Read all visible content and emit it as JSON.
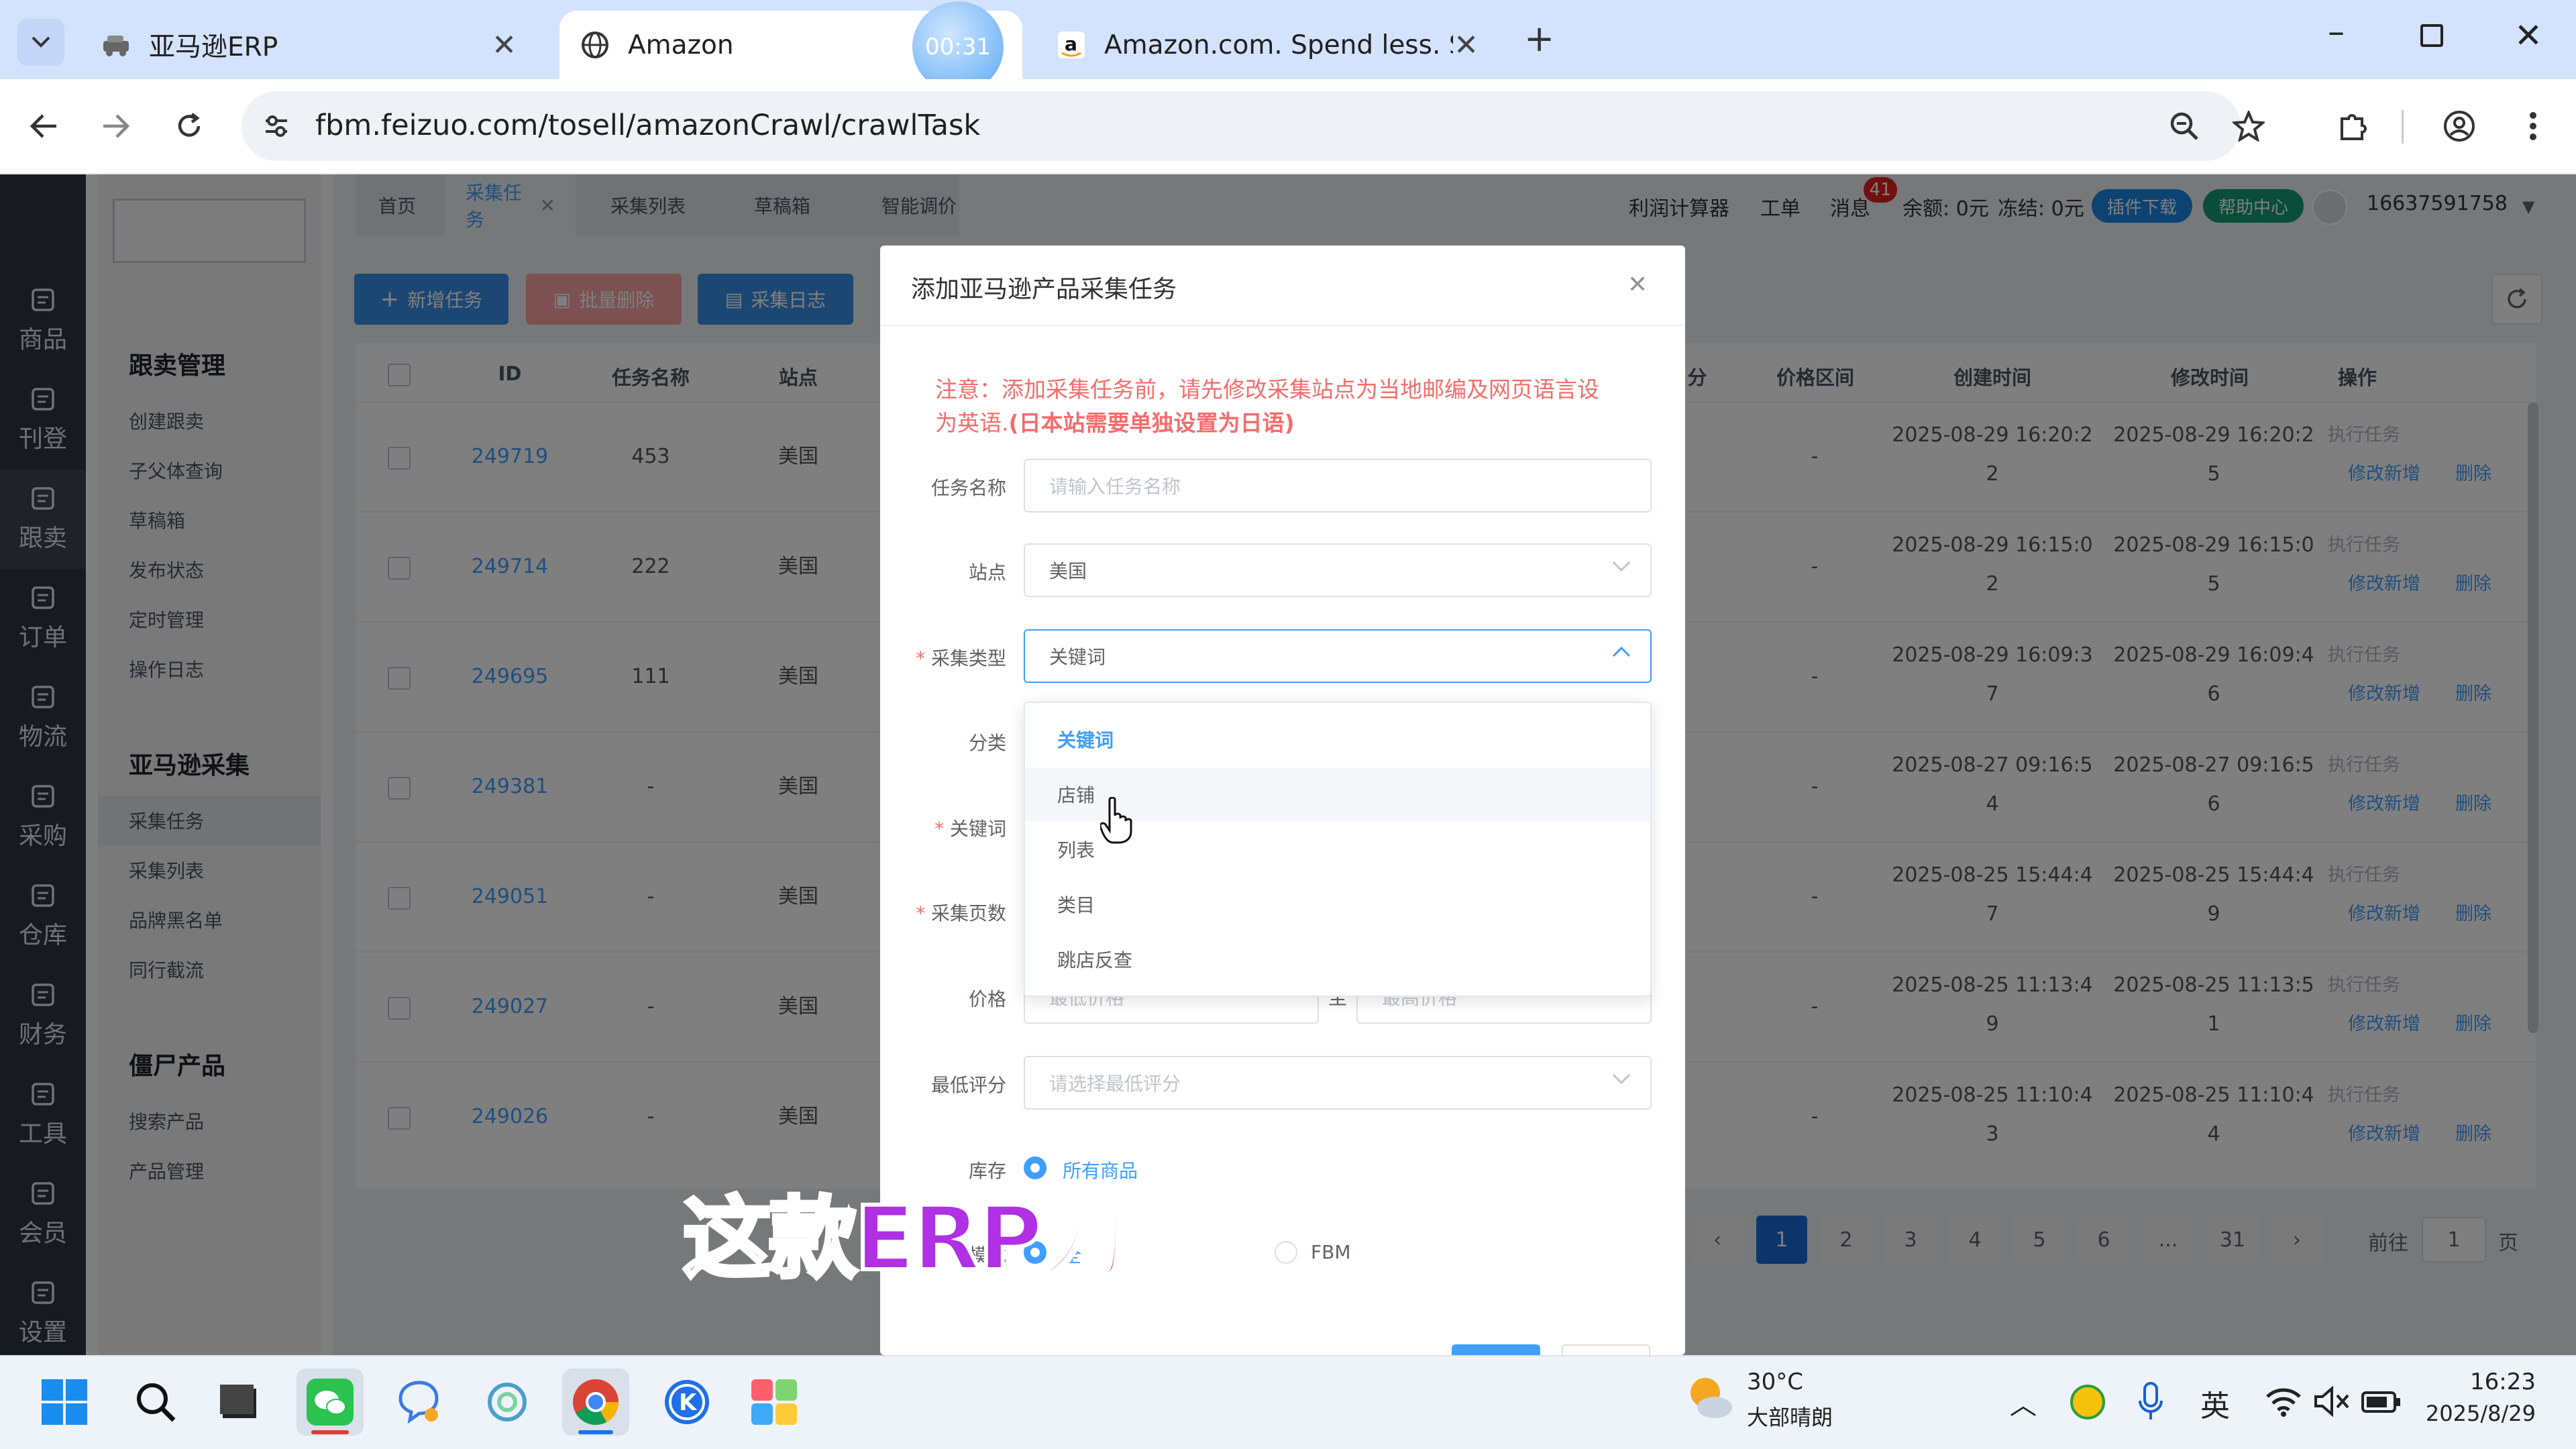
{
  "browser": {
    "tabs": [
      {
        "title": "亚马逊ERP",
        "icon": "car-icon"
      },
      {
        "title": "Amazon",
        "icon": "globe-icon",
        "active": true
      },
      {
        "title": "Amazon.com. Spend less. Sm",
        "icon": "amazon-icon"
      }
    ],
    "timer_badge": "00:31",
    "url": "fbm.feizuo.com/tosell/amazonCrawl/crawlTask"
  },
  "app": {
    "left_nav": [
      {
        "label": "商品",
        "icon": "box-icon"
      },
      {
        "label": "刊登",
        "icon": "publish-icon"
      },
      {
        "label": "跟卖",
        "icon": "follow-icon"
      },
      {
        "label": "订单",
        "icon": "order-icon"
      },
      {
        "label": "物流",
        "icon": "logistics-icon"
      },
      {
        "label": "采购",
        "icon": "cart-icon"
      },
      {
        "label": "仓库",
        "icon": "warehouse-icon"
      },
      {
        "label": "财务",
        "icon": "finance-icon"
      },
      {
        "label": "工具",
        "icon": "tool-icon"
      },
      {
        "label": "会员",
        "icon": "user-icon"
      },
      {
        "label": "设置",
        "icon": "settings-icon"
      }
    ],
    "sidebar": {
      "groups": [
        {
          "title": "跟卖管理",
          "items": [
            "创建跟卖",
            "子父体查询",
            "草稿箱",
            "发布状态",
            "定时管理",
            "操作日志"
          ]
        },
        {
          "title": "亚马逊采集",
          "items": [
            "采集任务",
            "采集列表",
            "品牌黑名单",
            "同行截流"
          ]
        },
        {
          "title": "僵尸产品",
          "items": [
            "搜索产品",
            "产品管理"
          ]
        }
      ]
    },
    "top_tabs": [
      "首页",
      "采集任务",
      "采集列表",
      "草稿箱",
      "智能调价"
    ],
    "header": {
      "links": [
        "利润计算器",
        "工单",
        "消息"
      ],
      "message_count": "41",
      "balance": "余额: 0元",
      "frozen": "冻结: 0元",
      "plugin_download": "插件下载",
      "help_center": "帮助中心",
      "phone": "16637591758"
    },
    "actions": {
      "add_task": "新增任务",
      "batch_delete": "批量删除",
      "log": "采集日志"
    },
    "table": {
      "headers": [
        "ID",
        "任务名称",
        "站点",
        "分",
        "价格区间",
        "创建时间",
        "修改时间",
        "操作"
      ],
      "rows": [
        {
          "id": "249719",
          "name": "453",
          "site": "美国",
          "price": "-",
          "created": [
            "2025-08-29 16:20:2",
            "2"
          ],
          "modified": [
            "2025-08-29 16:20:2",
            "5"
          ]
        },
        {
          "id": "249714",
          "name": "222",
          "site": "美国",
          "price": "-",
          "created": [
            "2025-08-29 16:15:0",
            "2"
          ],
          "modified": [
            "2025-08-29 16:15:0",
            "5"
          ]
        },
        {
          "id": "249695",
          "name": "111",
          "site": "美国",
          "price": "-",
          "created": [
            "2025-08-29 16:09:3",
            "7"
          ],
          "modified": [
            "2025-08-29 16:09:4",
            "6"
          ]
        },
        {
          "id": "249381",
          "name": "-",
          "site": "美国",
          "price": "-",
          "created": [
            "2025-08-27 09:16:5",
            "4"
          ],
          "modified": [
            "2025-08-27 09:16:5",
            "6"
          ]
        },
        {
          "id": "249051",
          "name": "-",
          "site": "美国",
          "price": "-",
          "created": [
            "2025-08-25 15:44:4",
            "7"
          ],
          "modified": [
            "2025-08-25 15:44:4",
            "9"
          ]
        },
        {
          "id": "249027",
          "name": "-",
          "site": "美国",
          "price": "-",
          "created": [
            "2025-08-25 11:13:4",
            "9"
          ],
          "modified": [
            "2025-08-25 11:13:5",
            "1"
          ]
        },
        {
          "id": "249026",
          "name": "-",
          "site": "美国",
          "price": "-",
          "created": [
            "2025-08-25 11:10:4",
            "3"
          ],
          "modified": [
            "2025-08-25 11:10:4",
            "4"
          ]
        }
      ],
      "op_execute": "执行任务",
      "op_edit": "修改新增",
      "op_delete": "删除"
    },
    "pagination": {
      "pages": [
        "1",
        "2",
        "3",
        "4",
        "5",
        "6",
        "...",
        "31"
      ],
      "goto_label": "前往",
      "goto_value": "1",
      "page_suffix": "页"
    }
  },
  "modal": {
    "title": "添加亚马逊产品采集任务",
    "notice_line1": "注意：添加采集任务前，请先修改采集站点为当地邮编及网页语言设",
    "notice_line2": "为英语.",
    "notice_bold": "(日本站需要单独设置为日语)",
    "fields": {
      "task_name": {
        "label": "任务名称",
        "placeholder": "请输入任务名称"
      },
      "site": {
        "label": "站点",
        "value": "美国"
      },
      "crawl_type": {
        "label": "采集类型",
        "value": "关键词"
      },
      "category": {
        "label": "分类"
      },
      "keyword": {
        "label": "关键词"
      },
      "pages": {
        "label": "采集页数"
      },
      "price": {
        "label": "价格",
        "min_placeholder": "最低价格",
        "sep": "至",
        "max_placeholder": "最高价格"
      },
      "min_rating": {
        "label": "最低评分",
        "placeholder": "请选择最低评分"
      },
      "stock": {
        "label": "库存",
        "option": "所有商品"
      },
      "mode": {
        "label": "模式",
        "option_all": "全",
        "option_fbm": "FBM"
      }
    },
    "dropdown_options": [
      "关键词",
      "店铺",
      "列表",
      "类目",
      "跳店反查"
    ]
  },
  "caption": "这款ERP为",
  "taskbar": {
    "weather_temp": "30°C",
    "weather_desc": "大部晴朗",
    "ime": "英",
    "time": "16:23",
    "date": "2025/8/29"
  },
  "colors": {
    "accent": "#409eff",
    "danger": "#f56c6c",
    "nav_bg": "#2e3440",
    "tab_bg": "#d3e3fd"
  }
}
